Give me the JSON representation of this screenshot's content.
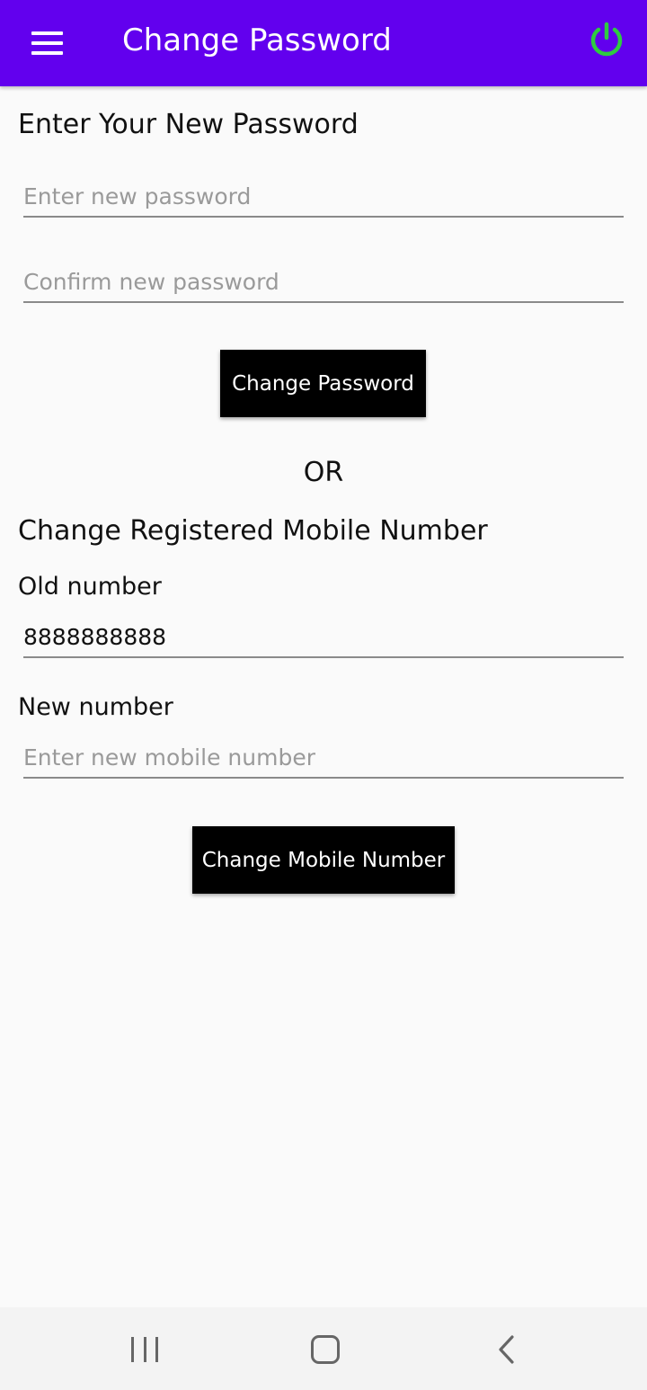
{
  "app_bar": {
    "title": "Change Password",
    "background": "#6200ee",
    "menu_icon": "hamburger-menu-icon",
    "power_icon": "power-icon",
    "power_color": "#2ecc40"
  },
  "password_section": {
    "heading": "Enter Your New Password",
    "new_password_placeholder": "Enter new password",
    "confirm_password_placeholder": "Confirm new password",
    "button_label": "Change Password"
  },
  "separator": "OR",
  "mobile_section": {
    "heading": "Change Registered Mobile Number",
    "old_label": "Old number",
    "old_value": "8888888888",
    "new_label": "New number",
    "new_placeholder": "Enter new mobile number",
    "button_label": "Change Mobile Number"
  },
  "nav_bar": {
    "recent_icon": "recent-apps-icon",
    "home_icon": "home-icon",
    "back_icon": "back-icon"
  }
}
